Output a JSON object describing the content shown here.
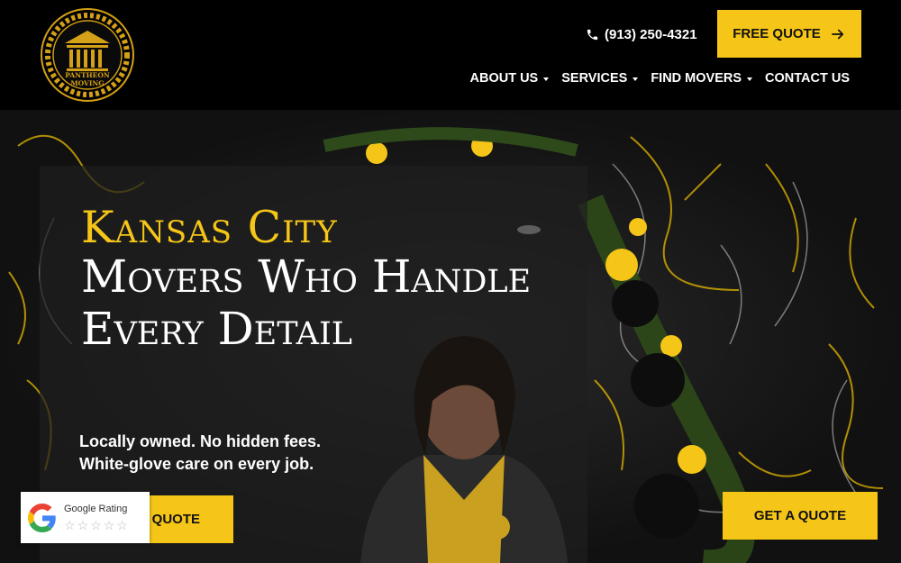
{
  "header": {
    "logo_text": "Pantheon Moving",
    "phone": "(913) 250-4321",
    "free_quote_label": "FREE QUOTE",
    "nav": [
      {
        "label": "ABOUT US",
        "has_dropdown": true
      },
      {
        "label": "SERVICES",
        "has_dropdown": true
      },
      {
        "label": "FIND MOVERS",
        "has_dropdown": true
      },
      {
        "label": "CONTACT US",
        "has_dropdown": false
      }
    ]
  },
  "hero": {
    "title_gold": "Kansas City",
    "title_white": "Movers Who Handle Every Detail",
    "subtitle_line1": "Locally owned. No hidden fees.",
    "subtitle_line2": "White-glove care on every job.",
    "cta_left_label": "A QUOTE",
    "cta_right_label": "GET A QUOTE"
  },
  "google_badge": {
    "label": "Google Rating",
    "stars_filled": 0,
    "stars_total": 5
  },
  "colors": {
    "accent": "#f5c518",
    "header_bg": "#000000"
  }
}
